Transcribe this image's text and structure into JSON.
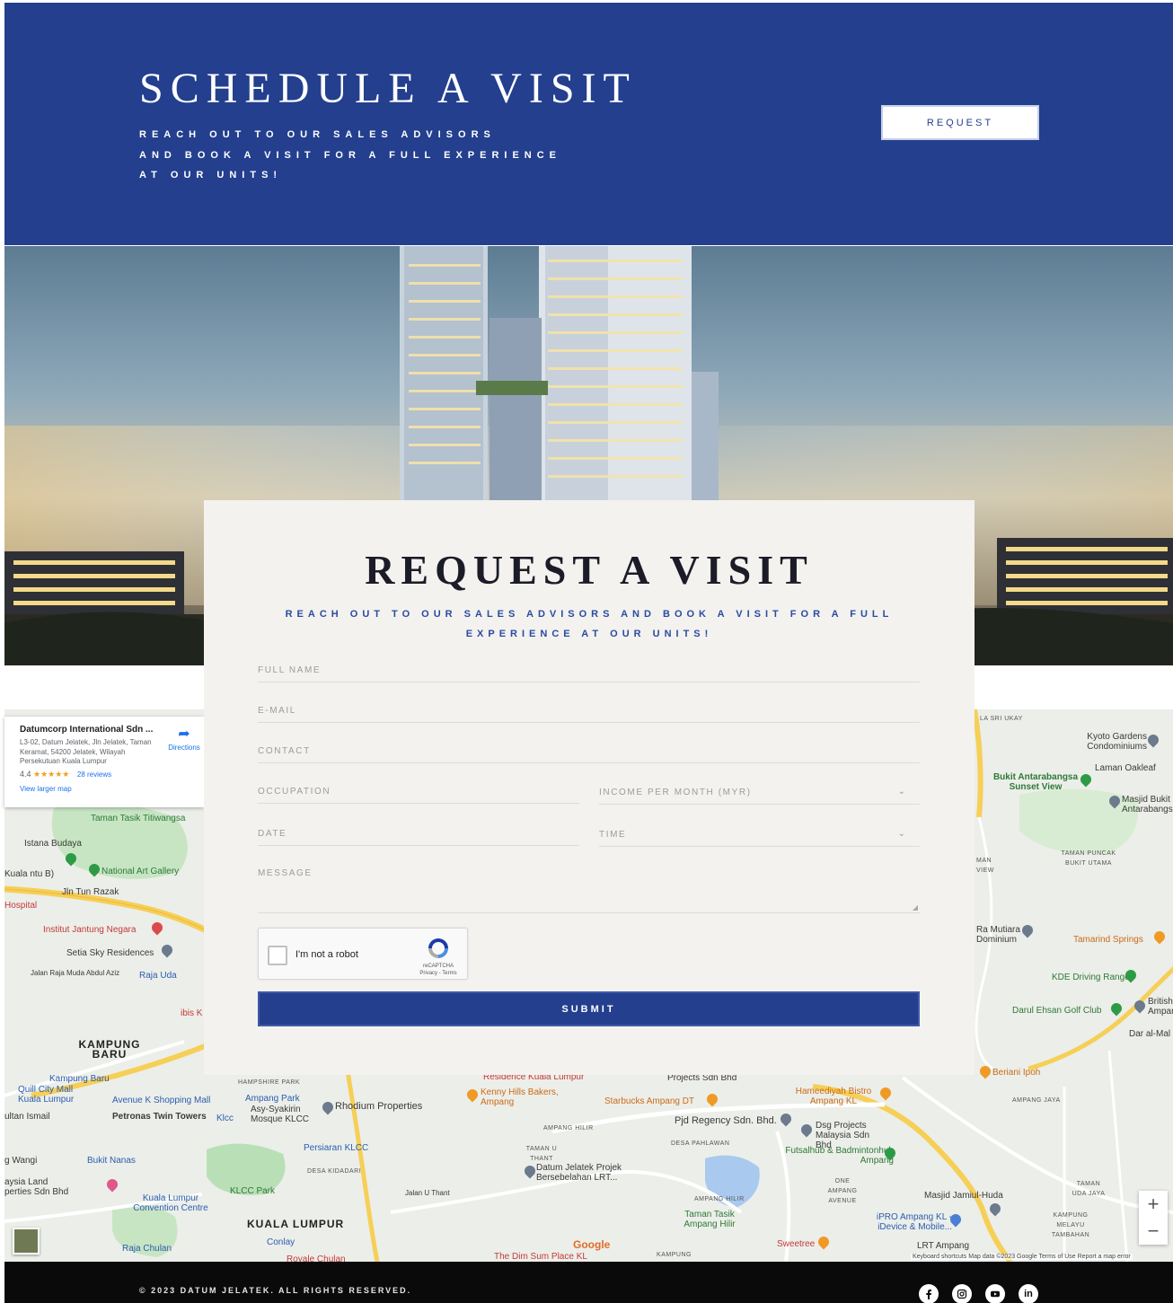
{
  "hero": {
    "title": "SCHEDULE A VISIT",
    "subtitle_lines": [
      "REACH OUT TO OUR SALES ADVISORS",
      "AND BOOK A VISIT FOR A FULL EXPERIENCE",
      "AT OUR UNITS!"
    ],
    "request_label": "REQUEST",
    "background_color": "#233f8e"
  },
  "form": {
    "title": "REQUEST A VISIT",
    "subtitle": "REACH OUT TO OUR SALES ADVISORS AND BOOK A VISIT FOR A FULL EXPERIENCE AT OUR UNITS!",
    "fields": {
      "full_name": "FULL NAME",
      "email": "E-MAIL",
      "contact": "CONTACT",
      "occupation": "OCCUPATION",
      "income": "INCOME PER MONTH (MYR)",
      "date": "DATE",
      "time": "TIME",
      "message": "MESSAGE"
    },
    "captcha": {
      "label": "I'm not a robot",
      "brand": "reCAPTCHA",
      "links": "Privacy - Terms"
    },
    "submit_label": "SUBMIT",
    "accent_color": "#233f8e"
  },
  "map": {
    "card": {
      "name": "Datumcorp International Sdn ...",
      "address": "L3-02, Datum Jelatek, Jln Jelatek, Taman Keramat, 54200 Jelatek, Wilayah Persekutuan Kuala Lumpur",
      "rating": "4.4",
      "stars": "★★★★★",
      "reviews": "28 reviews",
      "larger_map": "View larger map",
      "directions": "Directions"
    },
    "labels": {
      "taman_tasik": "Taman Tasik Titiwangsa",
      "istana": "Istana Budaya",
      "national_art": "National Art Gallery",
      "jln_tun_razak": "Jln Tun Razak",
      "hospital": "Hospital",
      "ijn": "Institut Jantung Negara",
      "setia_sky": "Setia Sky Residences",
      "jalan_raja_muda": "Jalan Raja Muda Abdul Aziz",
      "raja_uda": "Raja Uda",
      "kampung_baru": "KAMPUNG BARU",
      "kampung_baru_stn": "Kampung Baru",
      "quill": "Quill City Mall Kuala Lumpur",
      "avenue_k": "Avenue K Shopping Mall",
      "petronas": "Petronas Twin Towers",
      "klcc": "Klcc",
      "ampang_park": "Ampang Park",
      "asy_syakirin": "Asy-Syakirin Mosque KLCC",
      "rhodium": "Rhodium Properties",
      "persiaran_klcc": "Persiaran KLCC",
      "bukit_nanas": "Bukit Nanas",
      "klcc_park": "KLCC Park",
      "klcc_convention": "Kuala Lumpur Convention Centre",
      "kuala_lumpur": "KUALA LUMPUR",
      "conlay": "Conlay",
      "raja_chulan": "Raja Chulan",
      "kenny_hills": "Kenny Hills Bakers, Ampang",
      "starbucks": "Starbucks Ampang DT",
      "pjd_regency": "Pjd Regency Sdn. Bhd.",
      "datum_projek": "Datum Jelatek Projek Bersebelahan LRT...",
      "dsg_projects": "Dsg Projects Malaysia Sdn Bhd",
      "futsalhub": "Futsalhub & Badmintonhub Ampang",
      "hameediyah": "Hameediyah Bistro Ampang KL",
      "taman_tasik_ampang": "Taman Tasik Ampang Hilir",
      "sweetree": "Sweetree",
      "ipro": "iPRO Ampang KL - iDevice & Mobile...",
      "lrt_ampang": "LRT Ampang",
      "masjid_jamiul": "Masjid Jamiul-Huda",
      "dim_sum": "The Dim Sum Place KL",
      "kyoto": "Kyoto Gardens Condominiums",
      "laman_oakleaf": "Laman Oakleaf",
      "bukit_antarabangsa": "Bukit Antarabangsa Sunset View",
      "masjid_bukit": "Masjid Bukit Antarabangsa",
      "mutiara": "Ra Mutiara Dominium",
      "tamarind": "Tamarind Springs",
      "kde": "KDE Driving Range",
      "darul_ehsan": "Darul Ehsan Golf Club",
      "british": "British Ampang",
      "dar_al_mal": "Dar al-Mal",
      "beriani": "Beriani Ipoh",
      "projects_sdn": "Projects Sdn Bhd",
      "residence": "Residence Kuala Lumpur",
      "jalan_u_thant": "Jalan U Thant",
      "ampang_hilir": "AMPANG HILIR",
      "desa_pahlawan": "DESA PAHLAWAN",
      "desa_kudadari": "DESA KIDADARI",
      "taman_u_thant": "TAMAN U THANT",
      "one_ampang": "ONE AMPANG AVENUE",
      "ampang_jaya": "AMPANG JAYA",
      "taman_puncak": "TAMAN PUNCAK BUKIT UTAMA",
      "taman_uda_jaya": "TAMAN UDA JAYA",
      "kampung_melayu": "KAMPUNG MELAYU TAMBAHAN",
      "hampshire": "HAMPSHIRE PARK",
      "aysia_land": "aysia Land perties Sdn Bhd",
      "sultan_ismail": "ultan Ismail",
      "wangsa": "g Wangi",
      "kuala_stn": "Kuala ntu B)",
      "ibis": "ibis K",
      "sri_ukay": "LA SRI UKAY",
      "man_view": "MAN VIEW",
      "royale": "Royale Chulan",
      "kampung_pb": "KAMPUNG PERWIRA JAYA"
    },
    "google": "Google",
    "attribution": "Keyboard shortcuts   Map data ©2023 Google   Terms of Use   Report a map error",
    "zoom_in": "+",
    "zoom_out": "−"
  },
  "footer": {
    "copyright": "© 2023 DATUM JELATEK. ALL RIGHTS RESERVED.",
    "social": [
      "facebook-icon",
      "instagram-icon",
      "youtube-icon",
      "linkedin-icon"
    ],
    "linkedin_text": "in"
  }
}
